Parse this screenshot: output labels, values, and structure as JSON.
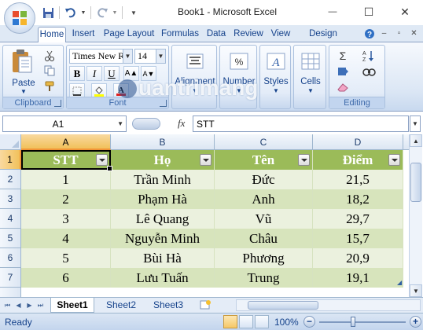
{
  "window": {
    "title": "Book1 - Microsoft Excel",
    "minimize_glyph": "—",
    "maximize_glyph": "☐",
    "close_glyph": "✕"
  },
  "qat": [
    "save-icon",
    "undo-icon",
    "redo-icon",
    "customize-qat-icon"
  ],
  "ribbon_tabs": [
    {
      "label": "Home",
      "active": true
    },
    {
      "label": "Insert"
    },
    {
      "label": "Page Layout"
    },
    {
      "label": "Formulas"
    },
    {
      "label": "Data"
    },
    {
      "label": "Review"
    },
    {
      "label": "View"
    },
    {
      "label": "Design"
    }
  ],
  "ribbon": {
    "clipboard": {
      "label": "Clipboard",
      "paste": "Paste"
    },
    "font": {
      "label": "Font",
      "name": "Times New Ro",
      "size": "14"
    },
    "alignment": {
      "label": "Alignment"
    },
    "number": {
      "label": "Number",
      "symbol": "%"
    },
    "styles": {
      "label": "Styles"
    },
    "cells": {
      "label": "Cells"
    },
    "editing": {
      "label": "Editing",
      "sum_symbol": "Σ"
    }
  },
  "watermark": "uantrimang",
  "formula_bar": {
    "name_box": "A1",
    "fx": "fx",
    "content": "STT"
  },
  "grid": {
    "columns": [
      "A",
      "B",
      "C",
      "D"
    ],
    "rows": [
      "1",
      "2",
      "3",
      "4",
      "5",
      "6",
      "7"
    ],
    "selected_cell": "A1",
    "header": [
      "STT",
      "Họ",
      "Tên",
      "Điểm"
    ],
    "data": [
      [
        "1",
        "Trần Minh",
        "Đức",
        "21,5"
      ],
      [
        "2",
        "Phạm Hà",
        "Anh",
        "18,2"
      ],
      [
        "3",
        "Lê Quang",
        "Vũ",
        "29,7"
      ],
      [
        "4",
        "Nguyễn Minh",
        "Châu",
        "15,7"
      ],
      [
        "5",
        "Bùi Hà",
        "Phương",
        "20,9"
      ],
      [
        "6",
        "Lưu Tuấn",
        "Trung",
        "19,1"
      ]
    ],
    "colors": {
      "header_bg": "#9bbb59",
      "band_light": "#ebf1de",
      "band_dark": "#d7e4bc",
      "selection": "#000000"
    }
  },
  "sheets": [
    {
      "label": "Sheet1",
      "active": true
    },
    {
      "label": "Sheet2"
    },
    {
      "label": "Sheet3"
    }
  ],
  "status": {
    "text": "Ready",
    "zoom": "100%"
  }
}
